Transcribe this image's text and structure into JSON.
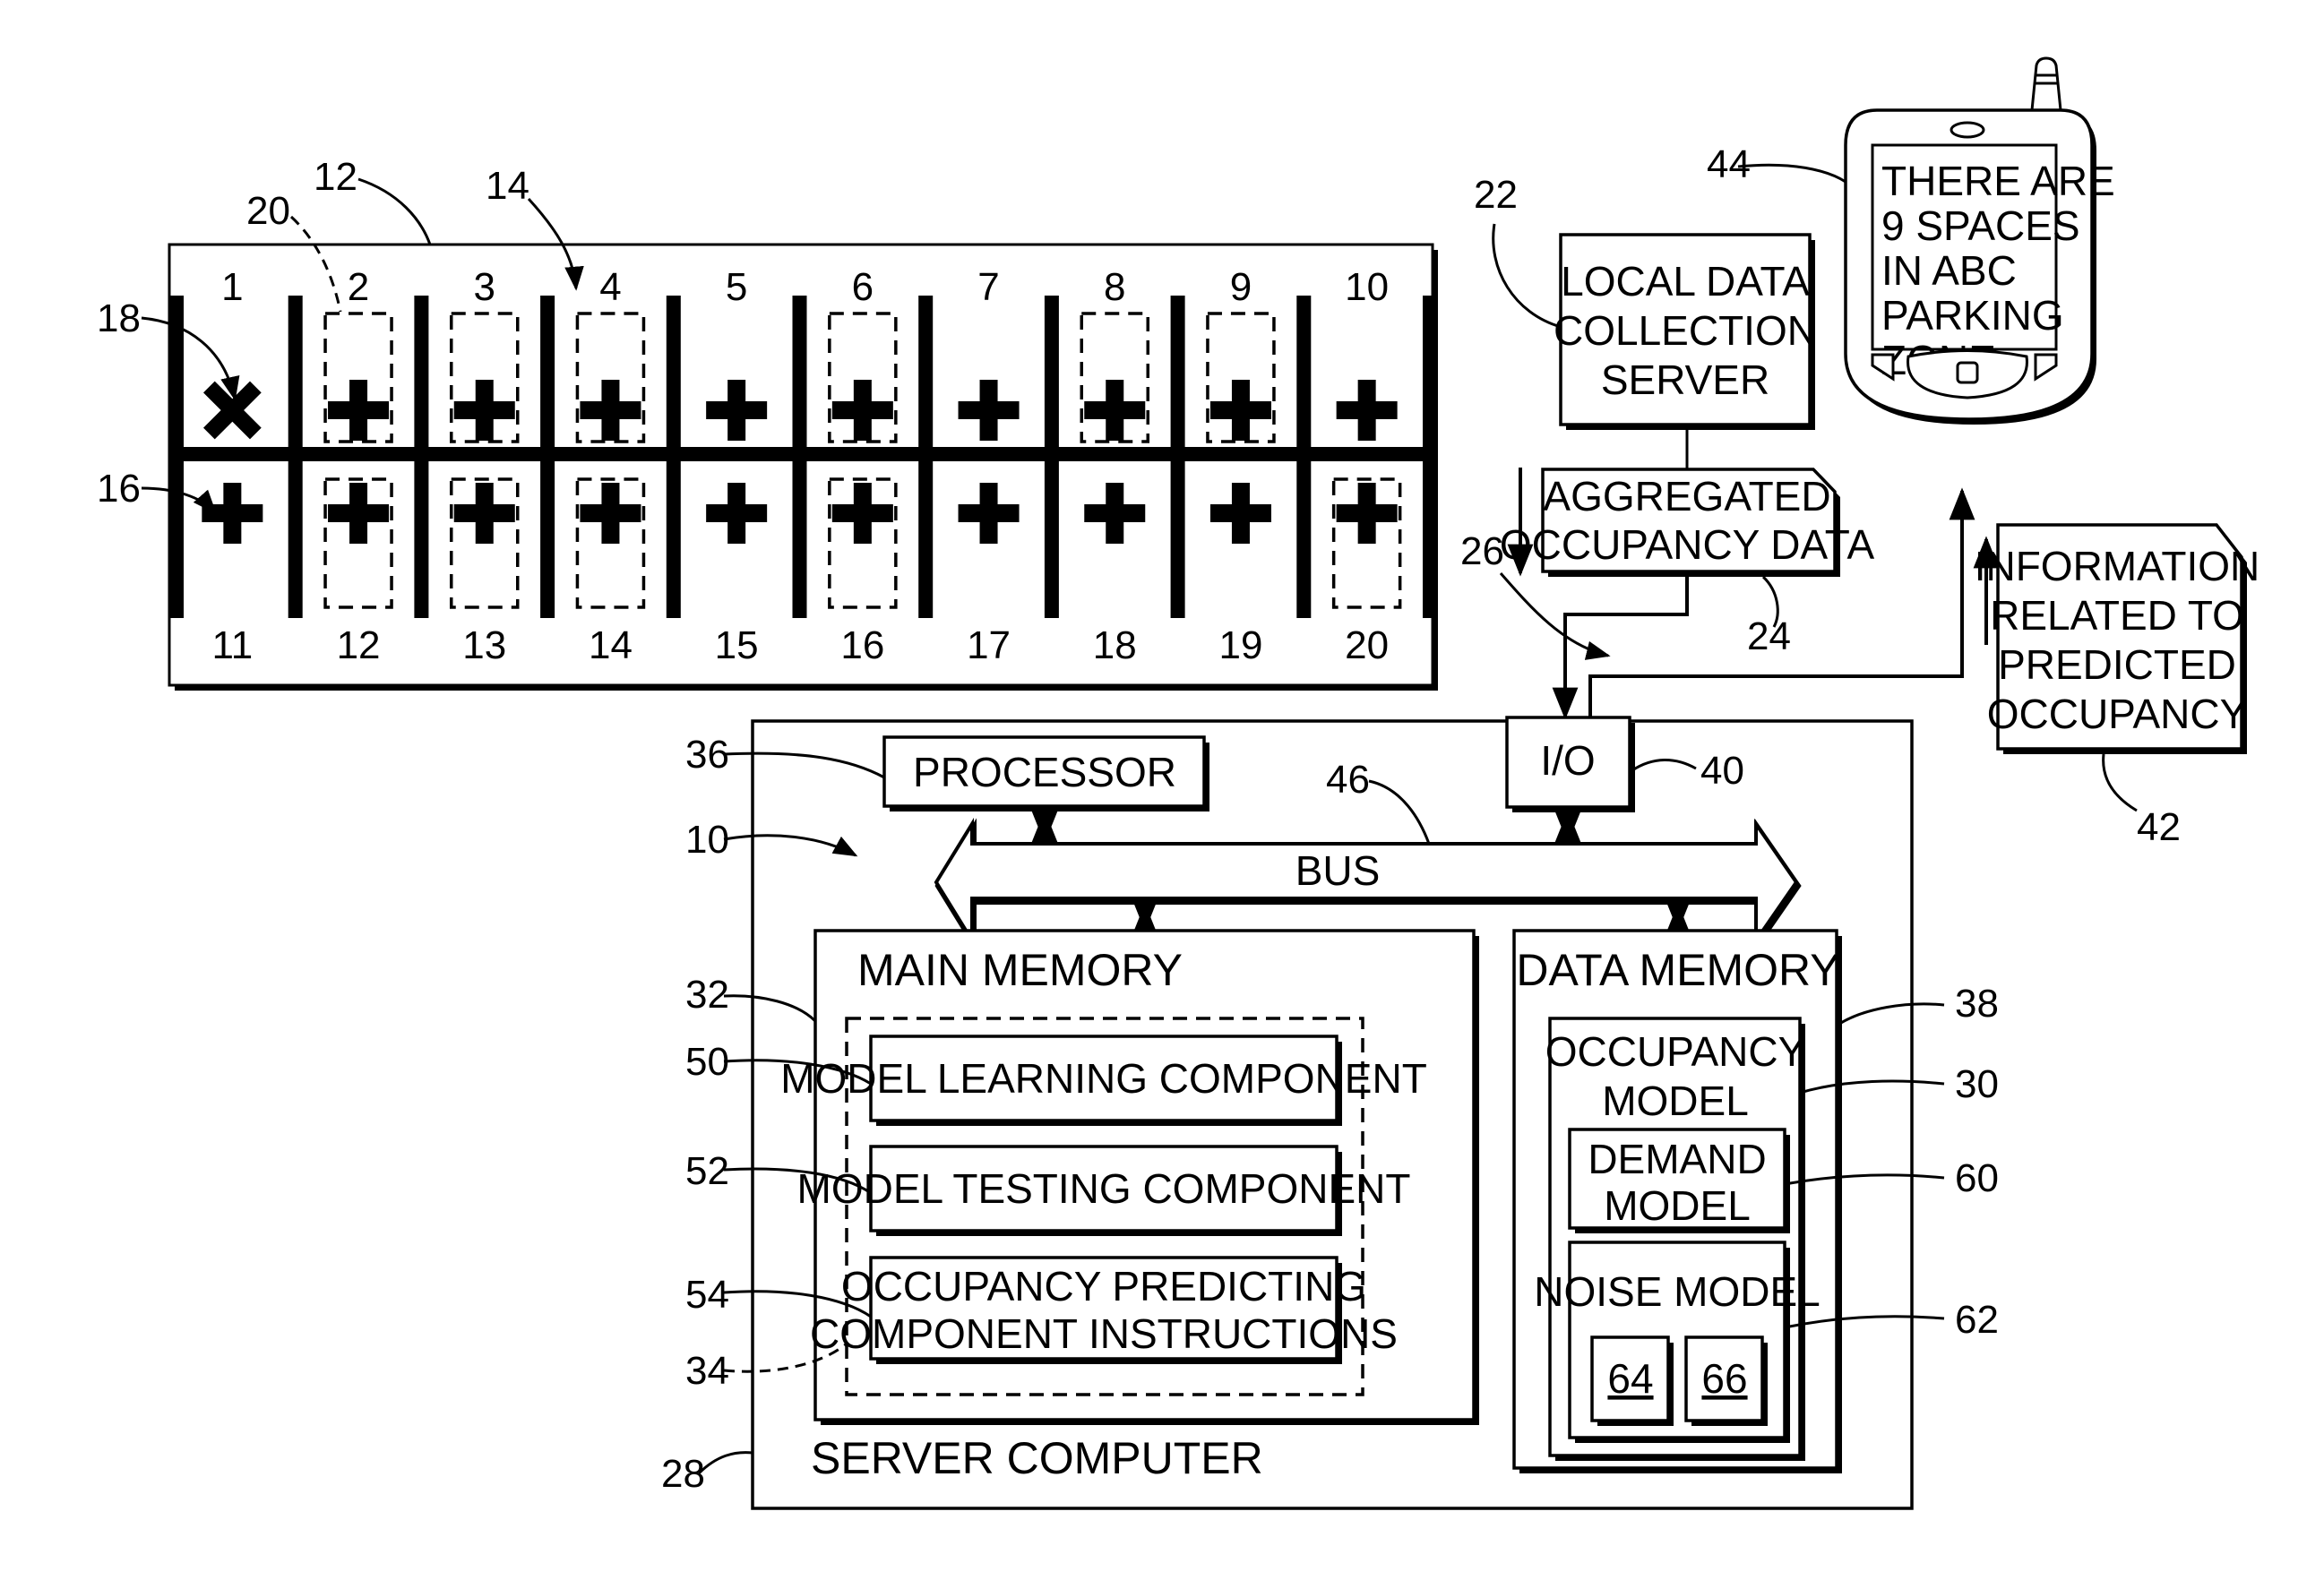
{
  "parking_lot": {
    "ref": "12",
    "ref_space": "14",
    "ref_occupied_marker": "18",
    "ref_vacant_marker": "16",
    "ref_vehicle_outline": "20",
    "top_row": [
      {
        "label": "1",
        "state": "occupied-x",
        "vehicle": false
      },
      {
        "label": "2",
        "state": "vacant-plus",
        "vehicle": true
      },
      {
        "label": "3",
        "state": "vacant-plus",
        "vehicle": true
      },
      {
        "label": "4",
        "state": "vacant-plus",
        "vehicle": true
      },
      {
        "label": "5",
        "state": "vacant-plus",
        "vehicle": false
      },
      {
        "label": "6",
        "state": "vacant-plus",
        "vehicle": true
      },
      {
        "label": "7",
        "state": "vacant-plus",
        "vehicle": false
      },
      {
        "label": "8",
        "state": "vacant-plus",
        "vehicle": true
      },
      {
        "label": "9",
        "state": "vacant-plus",
        "vehicle": true
      },
      {
        "label": "10",
        "state": "vacant-plus",
        "vehicle": false
      }
    ],
    "bottom_row": [
      {
        "label": "11",
        "state": "vacant-plus",
        "vehicle": false
      },
      {
        "label": "12",
        "state": "vacant-plus",
        "vehicle": true
      },
      {
        "label": "13",
        "state": "vacant-plus",
        "vehicle": true
      },
      {
        "label": "14",
        "state": "vacant-plus",
        "vehicle": true
      },
      {
        "label": "15",
        "state": "vacant-plus",
        "vehicle": false
      },
      {
        "label": "16",
        "state": "vacant-plus",
        "vehicle": true
      },
      {
        "label": "17",
        "state": "vacant-plus",
        "vehicle": false
      },
      {
        "label": "18",
        "state": "vacant-plus",
        "vehicle": false
      },
      {
        "label": "19",
        "state": "vacant-plus",
        "vehicle": false
      },
      {
        "label": "20",
        "state": "vacant-plus",
        "vehicle": true
      }
    ]
  },
  "local_server": {
    "ref": "22",
    "lines": [
      "LOCAL DATA",
      "COLLECTION",
      "SERVER"
    ]
  },
  "aggregated_data": {
    "ref": "24",
    "lines": [
      "AGGREGATED",
      "OCCUPANCY DATA"
    ]
  },
  "flow_ref": "26",
  "phone": {
    "ref": "44",
    "screen_lines": [
      "THERE ARE",
      "9 SPACES",
      "IN ABC",
      "PARKING",
      "ZONE"
    ]
  },
  "info_doc": {
    "ref": "42",
    "lines": [
      "INFORMATION",
      "RELATED TO",
      "PREDICTED",
      "OCCUPANCY"
    ]
  },
  "server_computer": {
    "ref": "28",
    "label": "SERVER COMPUTER",
    "system_ref": "10",
    "processor": {
      "ref": "36",
      "label": "PROCESSOR"
    },
    "io": {
      "ref": "40",
      "label": "I/O"
    },
    "bus": {
      "ref": "46",
      "label": "BUS"
    },
    "main_memory": {
      "ref": "32",
      "label": "MAIN MEMORY",
      "instructions_ref": "34",
      "components": [
        {
          "ref": "50",
          "lines": [
            "MODEL LEARNING COMPONENT"
          ]
        },
        {
          "ref": "52",
          "lines": [
            "MODEL TESTING COMPONENT"
          ]
        },
        {
          "ref": "54",
          "lines": [
            "OCCUPANCY PREDICTING",
            "COMPONENT INSTRUCTIONS"
          ]
        }
      ]
    },
    "data_memory": {
      "ref": "38",
      "label": "DATA MEMORY",
      "occupancy_model": {
        "ref": "30",
        "lines": [
          "OCCUPANCY",
          "MODEL"
        ]
      },
      "demand_model": {
        "ref": "60",
        "lines": [
          "DEMAND",
          "MODEL"
        ]
      },
      "noise_model": {
        "ref": "62",
        "label": "NOISE MODEL",
        "parts": [
          "64",
          "66"
        ]
      }
    }
  }
}
